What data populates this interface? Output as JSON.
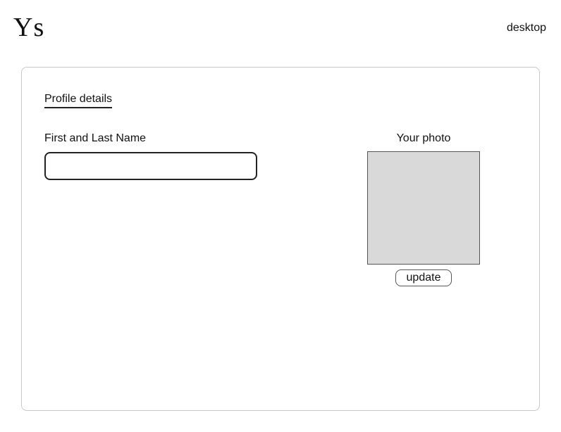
{
  "header": {
    "logo_text": "Ys",
    "device_label": "desktop"
  },
  "profile": {
    "tab_label": "Profile details",
    "name_field": {
      "label": "First and Last Name",
      "value": "",
      "placeholder": ""
    },
    "photo": {
      "label": "Your photo",
      "update_label": "update"
    }
  },
  "colors": {
    "card_border": "#c8c8c8",
    "photo_placeholder": "#d9d9d9",
    "text": "#111111"
  }
}
